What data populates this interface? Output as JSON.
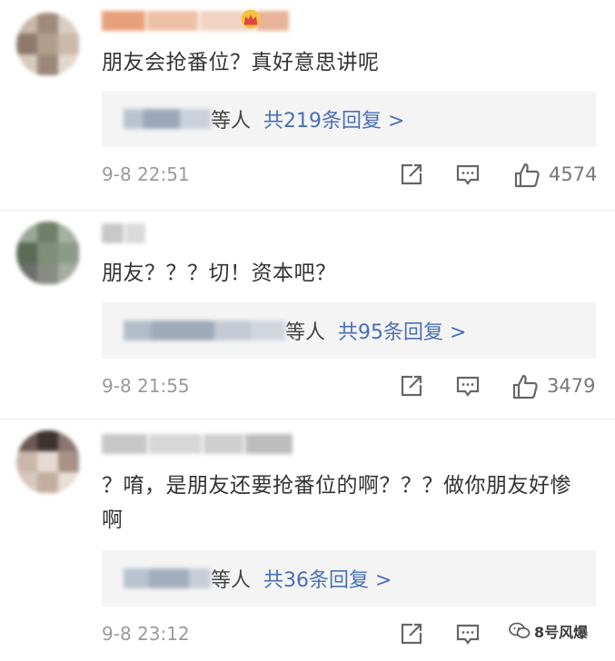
{
  "comments": [
    {
      "content": "朋友会抢番位？真好意思讲呢",
      "reply_suffix": "等人",
      "reply_count": "共219条回复 >",
      "time": "9-8 22:51",
      "likes": "4574"
    },
    {
      "content": "朋友？？？切！资本吧？",
      "reply_suffix": "等人",
      "reply_count": "共95条回复 >",
      "time": "9-8 21:55",
      "likes": "3479"
    },
    {
      "content": "？唷，是朋友还要抢番位的啊？？？做你朋友好惨啊",
      "reply_suffix": "等人",
      "reply_count": "共36条回复 >",
      "time": "9-8 23:12",
      "likes": ""
    }
  ],
  "watermark": "8号风爆",
  "colors": {
    "link": "#4a6fb5",
    "meta": "#9a9a9a",
    "reply_bg": "#f4f4f4"
  }
}
